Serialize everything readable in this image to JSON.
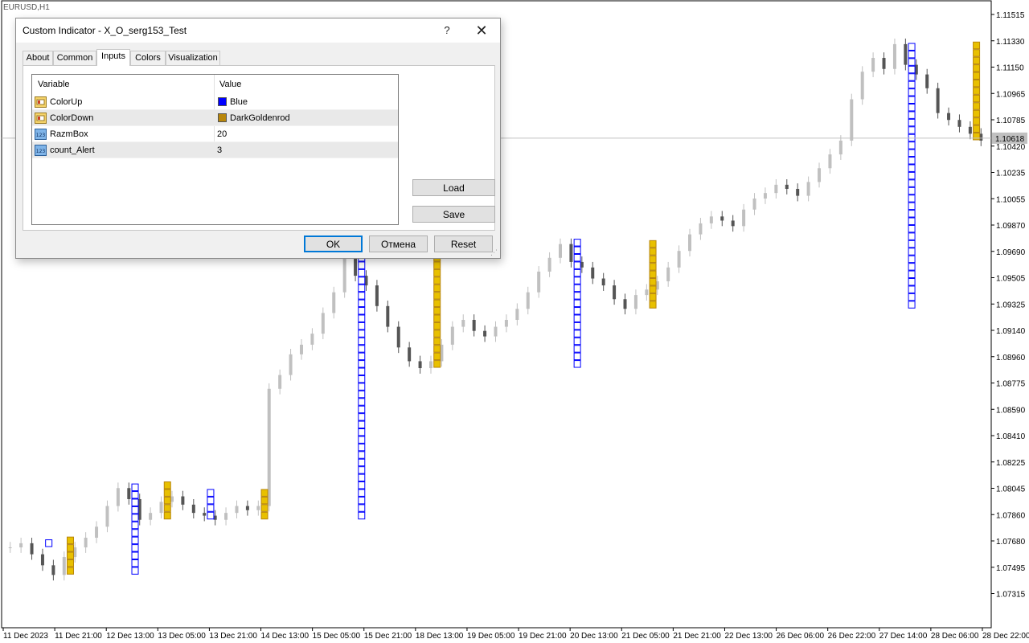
{
  "window": {
    "symbol": "EURUSD,H1"
  },
  "dialog": {
    "title": "Custom Indicator - X_O_serg153_Test",
    "help_label": "?",
    "close_label": "✕",
    "tabs": [
      {
        "label": "About"
      },
      {
        "label": "Common"
      },
      {
        "label": "Inputs",
        "active": true
      },
      {
        "label": "Colors"
      },
      {
        "label": "Visualization"
      }
    ],
    "grid": {
      "headers": {
        "variable": "Variable",
        "value": "Value"
      },
      "rows": [
        {
          "name": "ColorUp",
          "value": "Blue",
          "icon": "color-param-icon",
          "swatch": "#0000ff"
        },
        {
          "name": "ColorDown",
          "value": "DarkGoldenrod",
          "icon": "color-param-icon",
          "swatch": "#b8860b"
        },
        {
          "name": "RazmBox",
          "value": "20",
          "icon": "integer-param-icon",
          "icon_text": "123"
        },
        {
          "name": "count_Alert",
          "value": "3",
          "icon": "integer-param-icon",
          "icon_text": "123"
        }
      ]
    },
    "load_label": "Load",
    "save_label": "Save",
    "ok_label": "OK",
    "cancel_label": "Отмена",
    "reset_label": "Reset"
  },
  "chart_data": {
    "type": "candlestick",
    "symbol": "EURUSD,H1",
    "colors": {
      "up_box": "#0000ff",
      "down_box": "#b8860b",
      "down_fill": "#e8c000",
      "candle_up": "#c0c0c0",
      "candle_down": "#555555",
      "price_line": "#c0c0c0",
      "price_label_bg": "#c0c0c0"
    },
    "y_axis": {
      "ticks": [
        "1.11515",
        "1.11330",
        "1.11150",
        "1.10965",
        "1.10785",
        "1.10420",
        "1.10235",
        "1.10055",
        "1.09870",
        "1.09690",
        "1.09505",
        "1.09325",
        "1.09140",
        "1.08960",
        "1.08775",
        "1.08590",
        "1.08410",
        "1.08225",
        "1.08045",
        "1.07860",
        "1.07680",
        "1.07495",
        "1.07315"
      ],
      "ylim": [
        1.07315,
        1.11515
      ],
      "current_price": "1.10618"
    },
    "x_axis": {
      "ticks": [
        "11 Dec 2023",
        "11 Dec 21:00",
        "12 Dec 13:00",
        "13 Dec 05:00",
        "13 Dec 21:00",
        "14 Dec 13:00",
        "15 Dec 05:00",
        "15 Dec 21:00",
        "18 Dec 13:00",
        "19 Dec 05:00",
        "19 Dec 21:00",
        "20 Dec 13:00",
        "21 Dec 05:00",
        "21 Dec 21:00",
        "22 Dec 13:00",
        "26 Dec 06:00",
        "26 Dec 22:00",
        "27 Dec 14:00",
        "28 Dec 06:00",
        "28 Dec 22:00"
      ]
    },
    "close_series": [
      1.0765,
      1.0768,
      1.076,
      1.0752,
      1.0745,
      1.0758,
      1.0765,
      1.0772,
      1.078,
      1.0795,
      1.0808,
      1.08,
      1.0785,
      1.079,
      1.0798,
      1.0802,
      1.0796,
      1.079,
      1.0788,
      1.0785,
      1.079,
      1.0795,
      1.0792,
      1.0795,
      1.088,
      1.089,
      1.0905,
      1.0912,
      1.092,
      1.0935,
      1.095,
      1.0975,
      1.0962,
      1.0955,
      1.094,
      1.0925,
      1.091,
      1.09,
      1.0895,
      1.09,
      1.0912,
      1.0925,
      1.093,
      1.0922,
      1.0918,
      1.0925,
      1.093,
      1.0938,
      1.095,
      1.0965,
      1.0975,
      1.0985,
      1.0972,
      1.0968,
      1.096,
      1.0955,
      1.0945,
      1.0938,
      1.0948,
      1.0952,
      1.0958,
      1.0968,
      1.098,
      1.0992,
      1.1,
      1.1005,
      1.1002,
      1.0998,
      1.101,
      1.1018,
      1.1022,
      1.1028,
      1.1025,
      1.102,
      1.103,
      1.104,
      1.105,
      1.106,
      1.109,
      1.111,
      1.112,
      1.1112,
      1.113,
      1.1115,
      1.1108,
      1.1098,
      1.108,
      1.1075,
      1.107,
      1.1065,
      1.106
    ]
  }
}
